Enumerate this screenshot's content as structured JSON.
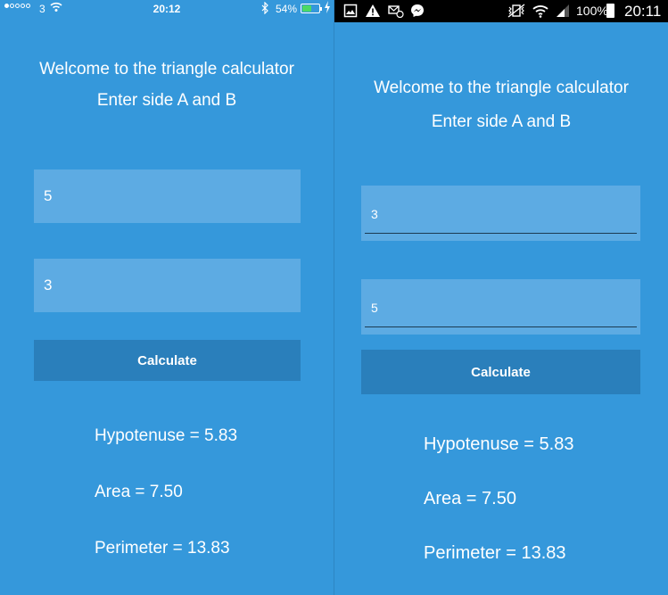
{
  "ios": {
    "status": {
      "carrier": "3",
      "time": "20:12",
      "battery_percent": "54%",
      "battery_level": 0.54,
      "icons": [
        "signal-dots-icon",
        "wifi-icon",
        "bluetooth-icon",
        "battery-icon",
        "charging-bolt-icon"
      ]
    },
    "title_line1": "Welcome to the triangle calculator",
    "title_line2": "Enter side A and B",
    "side_a_value": "5",
    "side_b_value": "3",
    "calculate_label": "Calculate",
    "hypotenuse": "Hypotenuse = 5.83",
    "area": "Area = 7.50",
    "perimeter": "Perimeter = 13.83"
  },
  "android": {
    "status": {
      "battery_percent": "100%",
      "time": "20:11",
      "icons": [
        "gallery-icon",
        "warning-icon",
        "missed-call-icon",
        "messenger-icon",
        "vibrate-muted-icon",
        "wifi-icon",
        "cell-signal-icon",
        "battery-icon"
      ]
    },
    "title_line1": "Welcome to the triangle calculator",
    "title_line2": "Enter side A and B",
    "side_a_value": "3",
    "side_b_value": "5",
    "calculate_label": "Calculate",
    "hypotenuse": "Hypotenuse = 5.83",
    "area": "Area = 7.50",
    "perimeter": "Perimeter = 13.83"
  },
  "colors": {
    "background": "#3598db",
    "field": "#5dabe3",
    "button": "#2a7fbb",
    "text": "#ffffff"
  }
}
